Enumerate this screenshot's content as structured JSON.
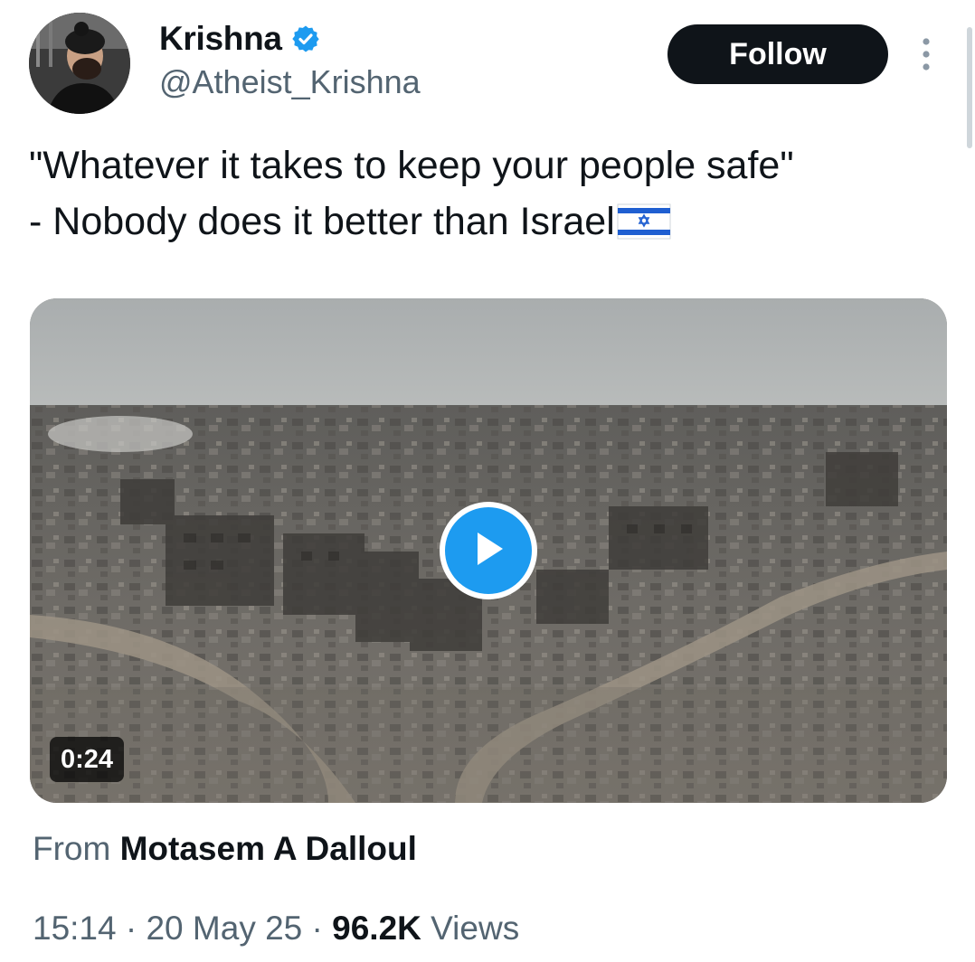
{
  "author": {
    "name": "Krishna",
    "handle": "@Atheist_Krishna",
    "verified": true,
    "avatar_icon": "profile-photo"
  },
  "follow_label": "Follow",
  "tweet": {
    "lines": [
      "\"Whatever it takes to keep your people safe\"",
      "- Nobody does it better than Israel"
    ],
    "flag_emoji": "israel-flag"
  },
  "media": {
    "duration": "0:24",
    "play_icon": "play-icon"
  },
  "source": {
    "from_label": "From",
    "author": "Motasem A Dalloul"
  },
  "meta": {
    "time": "15:14",
    "separator": "·",
    "date": "20 May 25",
    "views_count": "96.2K",
    "views_label": "Views"
  },
  "colors": {
    "accent": "#1d9bf0",
    "text": "#0f1419",
    "secondary": "#536471",
    "button_bg": "#0f1419"
  }
}
